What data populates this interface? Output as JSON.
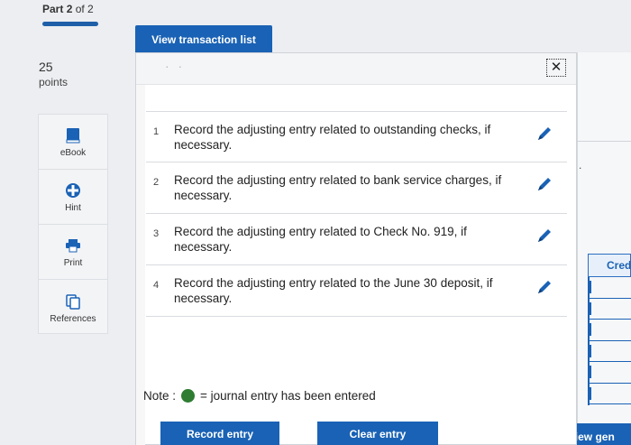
{
  "header": {
    "part_label": "Part",
    "part_num": "2",
    "part_of": "of 2"
  },
  "score": {
    "points": "25",
    "points_label": "points"
  },
  "tools": [
    {
      "label": "eBook",
      "icon": "book-icon"
    },
    {
      "label": "Hint",
      "icon": "hint-icon"
    },
    {
      "label": "Print",
      "icon": "print-icon"
    },
    {
      "label": "References",
      "icon": "references-icon"
    }
  ],
  "view_transaction_list": "View transaction list",
  "modal": {
    "close_glyph": "✕",
    "entries": [
      {
        "num": "1",
        "text": "Record the adjusting entry related to outstanding checks, if necessary."
      },
      {
        "num": "2",
        "text": "Record the adjusting entry related to bank service charges, if necessary."
      },
      {
        "num": "3",
        "text": "Record the adjusting entry related to Check No. 919, if necessary."
      },
      {
        "num": "4",
        "text": "Record the adjusting entry related to the June 30 deposit, if necessary."
      }
    ],
    "note_label": "Note :",
    "note_text": "= journal entry has been entered",
    "record_entry": "Record entry",
    "clear_entry": "Clear entry"
  },
  "background": {
    "credit_header": "Cred",
    "view_general": "View gen"
  },
  "colors": {
    "primary": "#1a62b5",
    "entered": "#2e7d32"
  }
}
